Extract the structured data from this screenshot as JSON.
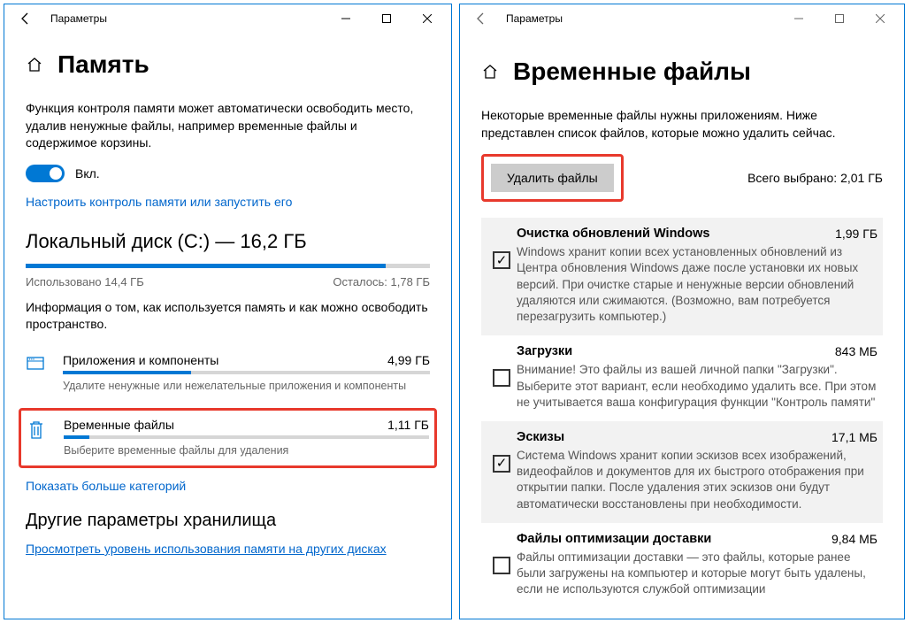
{
  "winL": {
    "title": "Параметры",
    "pageTitle": "Память",
    "desc": "Функция контроля памяти может автоматически освободить место, удалив ненужные файлы, например временные файлы и содержимое корзины.",
    "toggleLabel": "Вкл.",
    "configLink": "Настроить контроль памяти или запустить его",
    "disk": {
      "heading": "Локальный диск (C:) — 16,2 ГБ",
      "usedLabel": "Использовано 14,4 ГБ",
      "remainLabel": "Осталось: 1,78 ГБ",
      "fillPct": 89
    },
    "diskDesc": "Информация о том, как используется память и как можно освободить пространство.",
    "catApps": {
      "name": "Приложения и компоненты",
      "size": "4,99 ГБ",
      "hint": "Удалите ненужные или нежелательные приложения и компоненты",
      "fillPct": 35
    },
    "catTemp": {
      "name": "Временные файлы",
      "size": "1,11 ГБ",
      "hint": "Выберите временные файлы для удаления",
      "fillPct": 7
    },
    "showMore": "Показать больше категорий",
    "otherHeading": "Другие параметры хранилища",
    "otherLink": "Просмотреть уровень использования памяти на других дисках"
  },
  "winR": {
    "title": "Параметры",
    "pageTitle": "Временные файлы",
    "desc": "Некоторые временные файлы нужны приложениям. Ниже представлен список файлов, которые можно удалить сейчас.",
    "deleteBtn": "Удалить файлы",
    "totalSelected": "Всего выбрано: 2,01 ГБ",
    "items": [
      {
        "name": "Очистка обновлений Windows",
        "size": "1,99 ГБ",
        "checked": true,
        "desc": "Windows хранит копии всех установленных обновлений из Центра обновления Windows даже после установки их новых версий. При очистке старые и ненужные версии обновлений удаляются или сжимаются. (Возможно, вам потребуется перезагрузить компьютер.)"
      },
      {
        "name": "Загрузки",
        "size": "843 МБ",
        "checked": false,
        "desc": "Внимание! Это файлы из вашей личной папки \"Загрузки\". Выберите этот вариант, если необходимо удалить все. При этом не учитывается ваша конфигурация функции \"Контроль памяти\""
      },
      {
        "name": "Эскизы",
        "size": "17,1 МБ",
        "checked": true,
        "desc": "Система Windows хранит копии эскизов всех изображений, видеофайлов и документов для их быстрого отображения при открытии папки. После удаления этих эскизов они будут автоматически восстановлены при необходимости."
      },
      {
        "name": "Файлы оптимизации доставки",
        "size": "9,84 МБ",
        "checked": false,
        "desc": "Файлы оптимизации доставки — это файлы, которые ранее были загружены на компьютер и которые могут быть удалены, если не используются службой оптимизации"
      }
    ]
  }
}
